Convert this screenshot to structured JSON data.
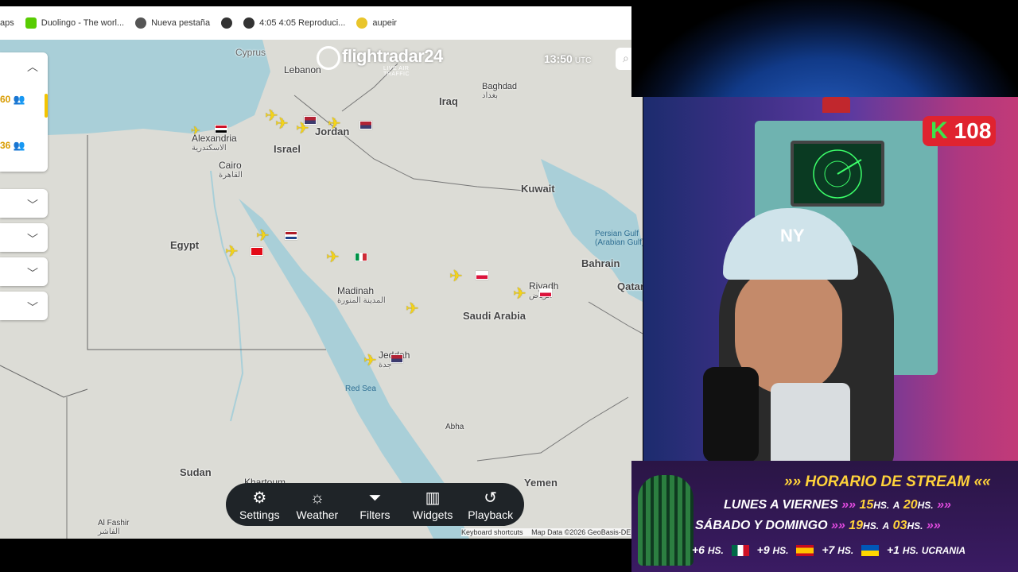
{
  "bookmarks": [
    {
      "label": "aps",
      "icon": "none"
    },
    {
      "label": "Duolingo - The worl...",
      "icon": "duolingo-icon"
    },
    {
      "label": "Nueva pestaña",
      "icon": "chrome-icon"
    },
    {
      "label": "",
      "icon": "globe-icon"
    },
    {
      "label": "4:05 4:05 Reproduci...",
      "icon": "globe-icon"
    },
    {
      "label": "aupeir",
      "icon": "aupeir-icon"
    }
  ],
  "map": {
    "logo_name": "flightradar24",
    "logo_sub": "LIVE AIR TRAFFIC",
    "time": "13:50",
    "time_zone": "UTC",
    "left_panel": {
      "count1": "60",
      "count2": "36"
    },
    "labels": {
      "cyprus": "Cyprus",
      "lebanon": "Lebanon",
      "baghdad": "Baghdad",
      "baghdad_ar": "بغداد",
      "iraq": "Iraq",
      "alexandria": "Alexandria",
      "alexandria_ar": "الاسكندرية",
      "israel": "Israel",
      "jordan": "Jordan",
      "cairo": "Cairo",
      "cairo_ar": "القاهرة",
      "kuwait": "Kuwait",
      "egypt": "Egypt",
      "persian_gulf": "Persian Gulf",
      "persian_gulf_alt": "(Arabian Gulf)",
      "bahrain": "Bahrain",
      "qatar": "Qatar",
      "madinah": "Madinah",
      "madinah_ar": "المدينة المنورة",
      "riyadh": "Riyadh",
      "riyadh_ar": "الرياض",
      "saudi_arabia": "Saudi Arabia",
      "jeddah": "Jeddah",
      "jeddah_ar": "جدة",
      "red_sea": "Red Sea",
      "abha": "Abha",
      "sudan": "Sudan",
      "khartoum": "Khartoum",
      "yemen": "Yemen",
      "al_fashir": "Al Fashir",
      "al_fashir_ar": "الفاشر"
    },
    "toolbar": [
      {
        "label": "Settings",
        "icon": "gear-icon"
      },
      {
        "label": "Weather",
        "icon": "weather-icon"
      },
      {
        "label": "Filters",
        "icon": "filter-icon"
      },
      {
        "label": "Widgets",
        "icon": "widgets-icon"
      },
      {
        "label": "Playback",
        "icon": "history-icon"
      }
    ],
    "attribution": {
      "shortcuts": "Keyboard shortcuts",
      "map_data": "Map Data ©2026 GeoBasis-DE"
    }
  },
  "stream": {
    "follower_count": "108",
    "banner_title": "HORARIO DE STREAM",
    "weekdays": "LUNES A VIERNES",
    "weekdays_from": "15",
    "weekdays_to": "20",
    "weekend": "SÁBADO Y DOMINGO",
    "weekend_from": "19",
    "weekend_to": "03",
    "hs": "HS.",
    "a": "A",
    "tz1": "+6",
    "tz2": "+9",
    "tz3": "+7",
    "tz4": "+1",
    "tz4_name": "UCRANIA",
    "accent": "#ffd23a"
  }
}
